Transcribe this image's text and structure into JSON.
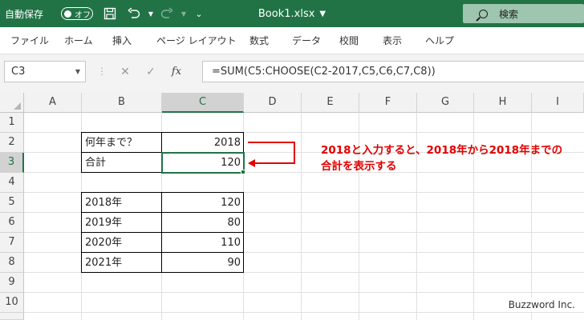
{
  "titlebar": {
    "autosave_label": "自動保存",
    "autosave_state": "オフ",
    "doc_title": "Book1.xlsx",
    "search_placeholder": "検索"
  },
  "ribbon_tabs": [
    "ファイル",
    "ホーム",
    "挿入",
    "ページ レイアウト",
    "数式",
    "データ",
    "校閲",
    "表示",
    "ヘルプ"
  ],
  "formula_bar": {
    "name_box": "C3",
    "formula": "=SUM(C5:CHOOSE(C2-2017,C5,C6,C7,C8))"
  },
  "columns": [
    "A",
    "B",
    "C",
    "D",
    "E",
    "F",
    "G",
    "H",
    "I"
  ],
  "rows": [
    "1",
    "2",
    "3",
    "4",
    "5",
    "6",
    "7",
    "8",
    "9",
    "10"
  ],
  "cells": {
    "b2": "何年まで？",
    "c2": "2018",
    "b3": "合計",
    "c3": "120",
    "b5": "2018年",
    "c5": "120",
    "b6": "2019年",
    "c6": "80",
    "b7": "2020年",
    "c7": "110",
    "b8": "2021年",
    "c8": "90"
  },
  "annotation": {
    "line1": "2018と入力すると、2018年から2018年までの",
    "line2": "合計を表示する"
  },
  "watermark": "Buzzword Inc.",
  "colors": {
    "excel_green": "#217346",
    "annotation_red": "#e20000"
  }
}
